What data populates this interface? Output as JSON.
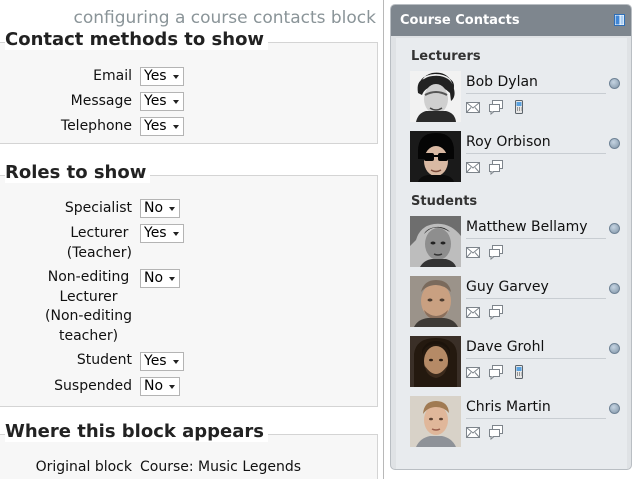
{
  "page": {
    "heading": "configuring a course contacts block"
  },
  "contact_methods": {
    "legend": "Contact methods to show",
    "fields": [
      {
        "label": "Email",
        "value": "Yes"
      },
      {
        "label": "Message",
        "value": "Yes"
      },
      {
        "label": "Telephone",
        "value": "Yes"
      }
    ]
  },
  "roles": {
    "legend": "Roles to show",
    "fields": [
      {
        "label": "Specialist",
        "value": "No"
      },
      {
        "label_lines": [
          "Lecturer",
          "(Teacher)"
        ],
        "value": "Yes"
      },
      {
        "label_lines": [
          "Non-editing",
          "Lecturer",
          "(Non-editing",
          "teacher)"
        ],
        "value": "No"
      },
      {
        "label": "Student",
        "value": "Yes"
      },
      {
        "label": "Suspended",
        "value": "No"
      }
    ]
  },
  "where": {
    "legend": "Where this block appears",
    "original_label": "Original block",
    "original_value": "Course: Music Legends"
  },
  "block": {
    "title": "Course Contacts",
    "groups": [
      {
        "title": "Lecturers",
        "contacts": [
          {
            "name": "Bob Dylan",
            "has_phone": true,
            "status_icon": "offline-status-icon"
          },
          {
            "name": "Roy Orbison",
            "has_phone": false,
            "status_icon": "offline-status-icon"
          }
        ]
      },
      {
        "title": "Students",
        "contacts": [
          {
            "name": "Matthew Bellamy",
            "has_phone": false,
            "status_icon": "offline-status-icon"
          },
          {
            "name": "Guy Garvey",
            "has_phone": false,
            "status_icon": "offline-status-icon"
          },
          {
            "name": "Dave Grohl",
            "has_phone": true,
            "status_icon": "offline-status-icon"
          },
          {
            "name": "Chris Martin",
            "has_phone": false,
            "status_icon": "offline-status-icon"
          }
        ]
      }
    ]
  },
  "colors": {
    "block_header": "#7e868e",
    "block_body": "#e8ebee",
    "fieldset_bg": "#f7f7f7",
    "heading_gray": "#8a9498"
  }
}
